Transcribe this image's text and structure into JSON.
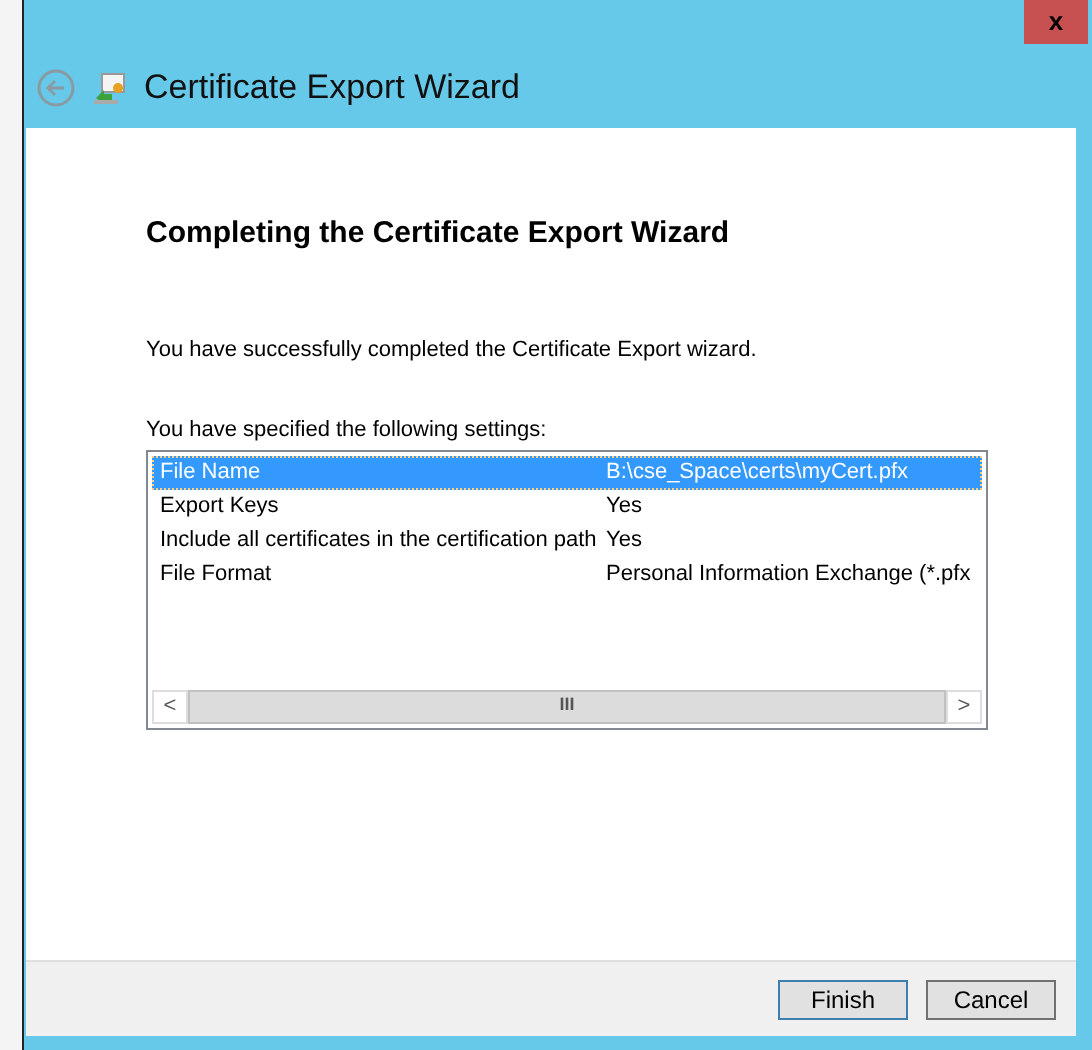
{
  "window": {
    "title": "Certificate Export Wizard",
    "close_label": "x"
  },
  "heading": "Completing the Certificate Export Wizard",
  "message": "You have successfully completed the Certificate Export wizard.",
  "settings_label": "You have specified the following settings:",
  "settings": [
    {
      "name": "File Name",
      "value": "B:\\cse_Space\\certs\\myCert.pfx",
      "selected": true
    },
    {
      "name": "Export Keys",
      "value": "Yes",
      "selected": false
    },
    {
      "name": "Include all certificates in the certification path",
      "value": "Yes",
      "selected": false
    },
    {
      "name": "File Format",
      "value": "Personal Information Exchange (*.pfx",
      "selected": false
    }
  ],
  "scrollbar": {
    "left": "<",
    "thumb": "III",
    "right": ">"
  },
  "buttons": [
    {
      "label": "Finish",
      "kind": "default"
    },
    {
      "label": "Cancel",
      "kind": "normal"
    }
  ]
}
